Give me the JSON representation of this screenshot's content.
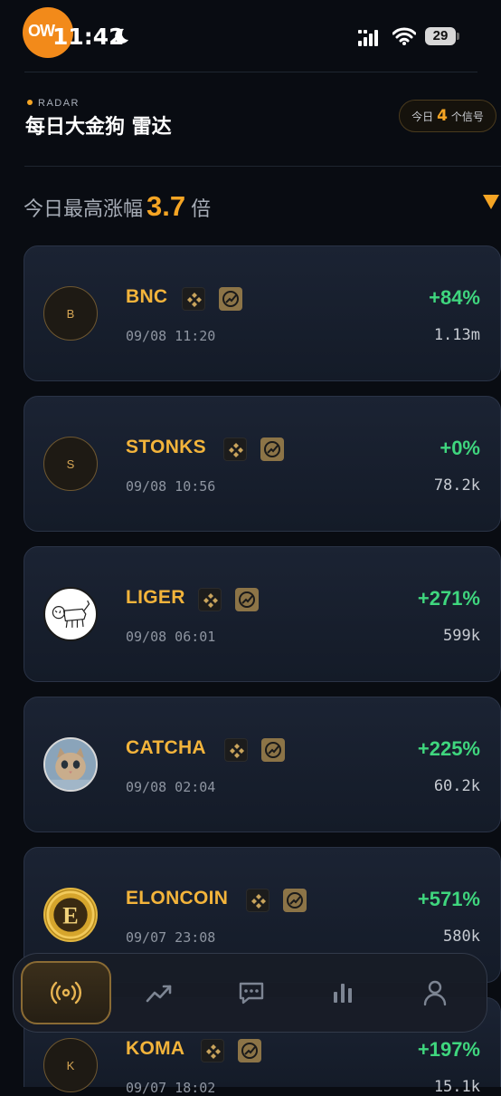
{
  "status_bar": {
    "time": "11:42",
    "battery": "29",
    "avatar_glyph": "OW"
  },
  "header": {
    "tag": "RADAR",
    "title": "每日大金狗 雷达",
    "signal_prefix": "今日",
    "signal_count": "4",
    "signal_suffix": "个信号"
  },
  "summary": {
    "label": "今日最高涨幅",
    "value": "3.7",
    "unit": "倍"
  },
  "colors": {
    "accent": "#f5a524",
    "positive": "#3fd67e",
    "card_bg": "#1b2333"
  },
  "coins": [
    {
      "letter": "B",
      "symbol": "BNC",
      "time": "09/08 11:20",
      "change": "+84%",
      "volume": "1.13m",
      "icon": "letter-avatar"
    },
    {
      "letter": "S",
      "symbol": "STONKS",
      "time": "09/08 10:56",
      "change": "+0%",
      "volume": "78.2k",
      "icon": "letter-avatar"
    },
    {
      "letter": "",
      "symbol": "LIGER",
      "time": "09/08 06:01",
      "change": "+271%",
      "volume": "599k",
      "icon": "liger-sketch-icon"
    },
    {
      "letter": "",
      "symbol": "CATCHA",
      "time": "09/08 02:04",
      "change": "+225%",
      "volume": "60.2k",
      "icon": "kitten-photo-icon"
    },
    {
      "letter": "",
      "symbol": "ELONCOIN",
      "time": "09/07 23:08",
      "change": "+571%",
      "volume": "580k",
      "icon": "elon-coin-icon"
    },
    {
      "letter": "K",
      "symbol": "KOMA",
      "time": "09/07 18:02",
      "change": "+197%",
      "volume": "15.1k",
      "icon": "letter-avatar"
    }
  ],
  "nav": [
    {
      "name": "radar",
      "icon": "broadcast-icon",
      "active": true
    },
    {
      "name": "trend",
      "icon": "trend-up-icon",
      "active": false
    },
    {
      "name": "chat",
      "icon": "chat-bubble-icon",
      "active": false
    },
    {
      "name": "stats",
      "icon": "bar-chart-icon",
      "active": false
    },
    {
      "name": "profile",
      "icon": "person-icon",
      "active": false
    }
  ]
}
